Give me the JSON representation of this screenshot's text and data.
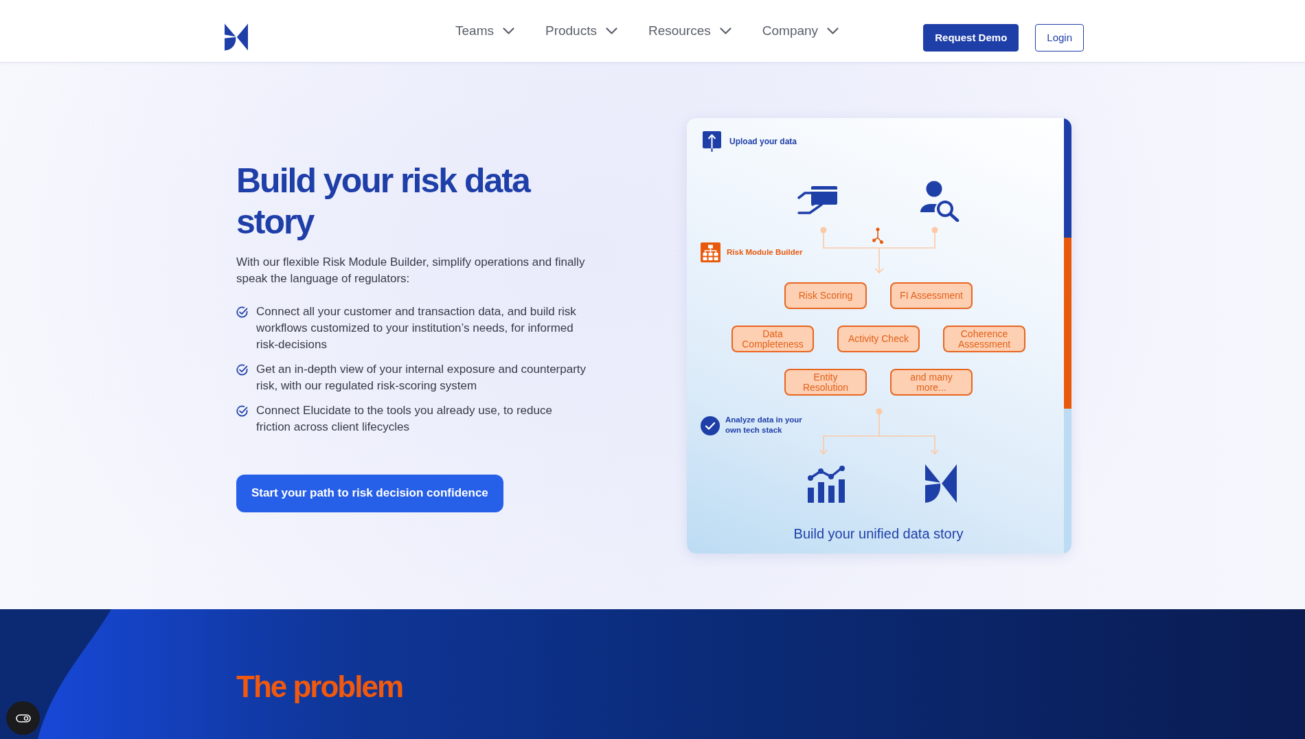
{
  "header": {
    "nav": [
      {
        "label": "Teams"
      },
      {
        "label": "Products"
      },
      {
        "label": "Resources"
      },
      {
        "label": "Company"
      }
    ],
    "buttons": [
      {
        "label": "Request Demo",
        "kind": "primary"
      },
      {
        "label": "Login",
        "kind": "outline"
      }
    ]
  },
  "hero": {
    "title": "Build your risk data story",
    "intro": "With our flexible Risk Module Builder, simplify operations and finally speak the language of regulators:",
    "bullets": [
      "Connect all your customer and transaction data, and build risk workflows customized to your institution’s needs, for informed risk-decisions",
      "Get an in-depth view of your internal exposure and counterparty risk, with our regulated risk-scoring system",
      "Connect Elucidate to the tools you already use, to reduce friction across client lifecycles"
    ],
    "cta": "Start your path to risk decision confidence"
  },
  "diagram": {
    "upload_label": "Upload your data",
    "builder_label": "Risk Module Builder",
    "module_rows": [
      [
        "Risk Scoring",
        "FI Assessment"
      ],
      [
        "Data Completeness",
        "Activity Check",
        "Coherence Assessment"
      ],
      [
        "Entity Resolution",
        "and many more..."
      ]
    ],
    "analyze_label": "Analyze data in your own tech stack",
    "caption": "Build your unified data story"
  },
  "problem_section": {
    "title": "The problem"
  }
}
